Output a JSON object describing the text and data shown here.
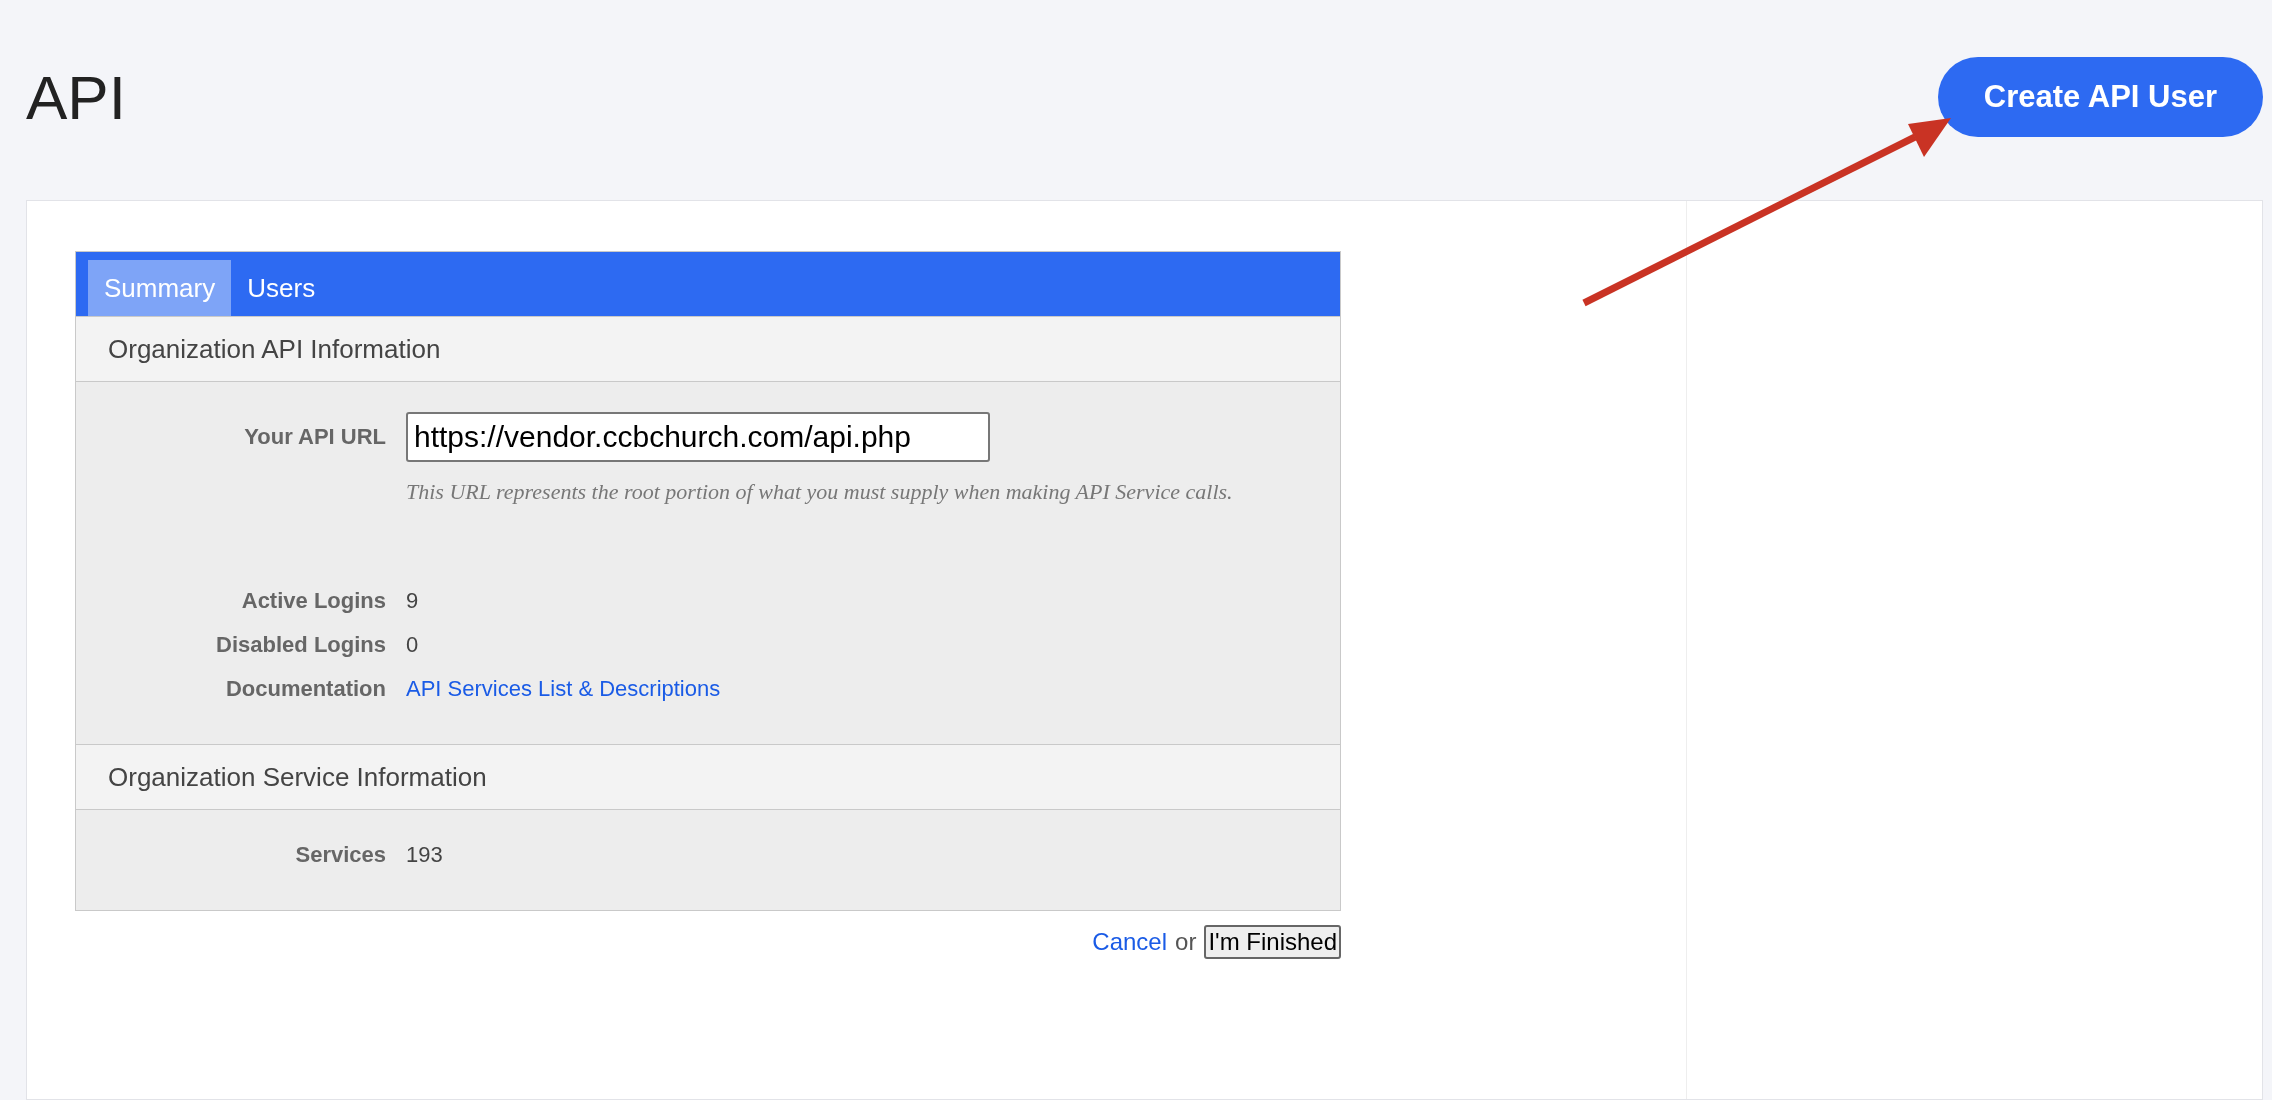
{
  "page_title": "API",
  "create_button": "Create API User",
  "tabs": [
    {
      "label": "Summary",
      "selected": true
    },
    {
      "label": "Users",
      "selected": false
    }
  ],
  "sections": [
    {
      "title": "Organization API Information",
      "fields": [
        {
          "label": "Your API URL",
          "kind": "input",
          "value": "https://vendor.ccbchurch.com/api.php",
          "hint": "This URL represents the root portion of what you must supply when making API Service calls."
        },
        {
          "label": "Active Logins",
          "kind": "text",
          "value": "9"
        },
        {
          "label": "Disabled Logins",
          "kind": "text",
          "value": "0"
        },
        {
          "label": "Documentation",
          "kind": "link",
          "value": "API Services List & Descriptions"
        }
      ]
    },
    {
      "title": "Organization Service Information",
      "fields": [
        {
          "label": "Services",
          "kind": "text",
          "value": "193"
        }
      ]
    }
  ],
  "footer": {
    "cancel": "Cancel",
    "separator": "or",
    "finish": "I'm Finished"
  }
}
